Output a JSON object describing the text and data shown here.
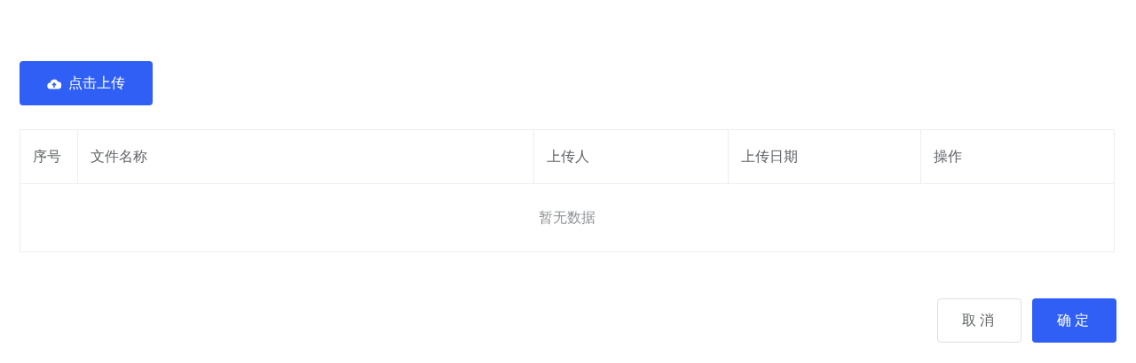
{
  "upload_button": {
    "label": "点击上传"
  },
  "table": {
    "columns": [
      "序号",
      "文件名称",
      "上传人",
      "上传日期",
      "操作"
    ],
    "empty_text": "暂无数据"
  },
  "footer_buttons": [
    {
      "label": "取消",
      "kind": "secondary"
    },
    {
      "label": "确定",
      "kind": "primary"
    }
  ]
}
